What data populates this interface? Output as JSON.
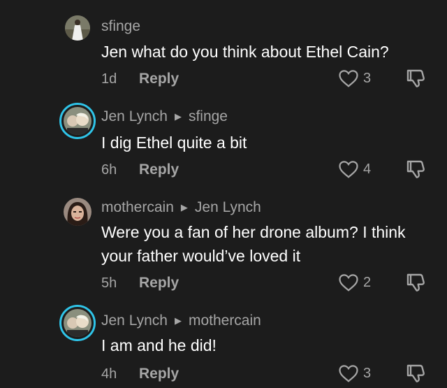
{
  "comments": [
    {
      "username": "sfinge",
      "reply_to": "",
      "text": "Jen what do you think about Ethel Cain?",
      "age": "1d",
      "reply_label": "Reply",
      "likes": "3",
      "avatar_style": "plain"
    },
    {
      "username": "Jen Lynch",
      "reply_to": "sfinge",
      "text": "I dig Ethel quite a bit",
      "age": "6h",
      "reply_label": "Reply",
      "likes": "4",
      "avatar_style": "ring"
    },
    {
      "username": "mothercain",
      "reply_to": "Jen Lynch",
      "text": "Were you a fan of her drone album? I think your father would’ve loved it",
      "age": "5h",
      "reply_label": "Reply",
      "likes": "2",
      "avatar_style": "plain"
    },
    {
      "username": "Jen Lynch",
      "reply_to": "mothercain",
      "text": "I am and he did!",
      "age": "4h",
      "reply_label": "Reply",
      "likes": "3",
      "avatar_style": "ring"
    }
  ],
  "colors": {
    "background": "#1c1c1c",
    "text": "#ffffff",
    "muted": "#a6a6a6",
    "ring": "#2fc4e8"
  },
  "icons": [
    "heart-icon",
    "dislike-icon",
    "reply-arrow-icon"
  ]
}
